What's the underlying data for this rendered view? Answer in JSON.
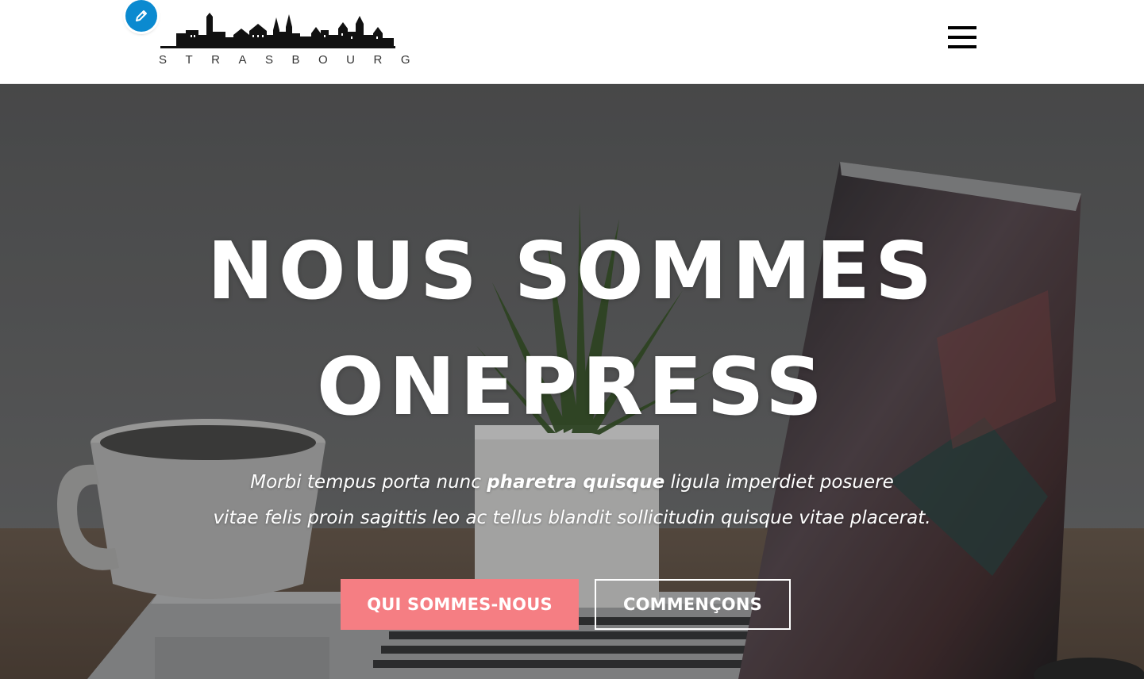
{
  "header": {
    "logo_wordmark": "STRASBOURG",
    "edit_icon": "pencil-icon",
    "menu_icon": "hamburger-icon"
  },
  "hero": {
    "title_line1": "NOUS SOMMES",
    "title_line2": "ONEPRESS",
    "subtitle_line1_before": "Morbi tempus porta nunc ",
    "subtitle_line1_bold": "pharetra quisque",
    "subtitle_line1_after": " ligula imperdiet posuere",
    "subtitle_line2": "vitae felis proin sagittis leo ac tellus blandit sollicitudin quisque vitae placerat.",
    "primary_button": "QUI SOMMES-NOUS",
    "secondary_button": "COMMENÇONS"
  },
  "colors": {
    "accent": "#f57e83",
    "edit_badge": "#0b8ad0",
    "header_bg": "#ffffff",
    "hero_text": "#ffffff"
  }
}
